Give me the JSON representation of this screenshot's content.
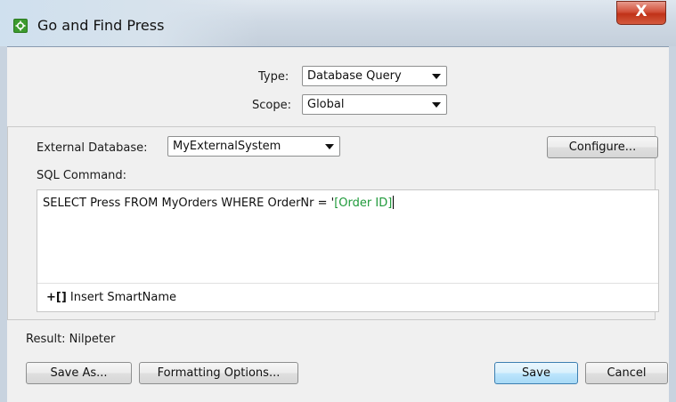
{
  "window": {
    "title": "Go and Find Press",
    "close_glyph": "X"
  },
  "form": {
    "type_label": "Type:",
    "type_value": "Database Query",
    "scope_label": "Scope:",
    "scope_value": "Global"
  },
  "query": {
    "external_db_label": "External Database:",
    "external_db_value": "MyExternalSystem",
    "configure_button": "Configure...",
    "sql_label": "SQL Command:",
    "sql_prefix": "SELECT Press FROM MyOrders WHERE OrderNr = '",
    "sql_smartname": "[Order ID]",
    "insert_smartname_icon": "+[]",
    "insert_smartname_label": "Insert SmartName"
  },
  "result": {
    "text": "Result: Nilpeter"
  },
  "footer": {
    "save_as": "Save As...",
    "formatting_options": "Formatting Options...",
    "save": "Save",
    "cancel": "Cancel"
  },
  "icons": {
    "app": "gear-icon",
    "close": "close-icon",
    "dropdown": "chevron-down-icon",
    "insert": "insert-smartname-icon"
  },
  "colors": {
    "smartname_text": "#1f9a3a",
    "close_button": "#c8452d",
    "app_icon": "#3c9a2e"
  }
}
